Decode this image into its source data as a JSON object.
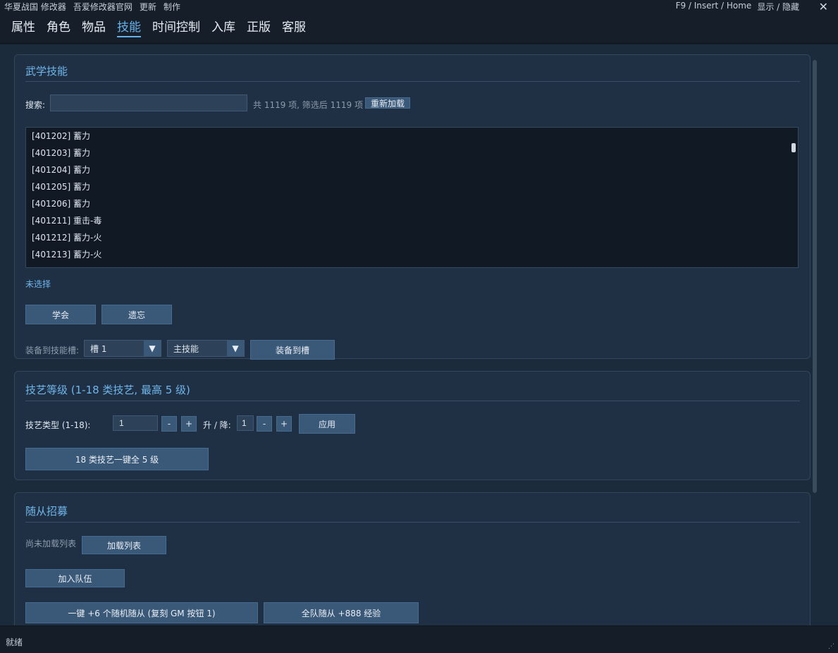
{
  "topbar": {
    "menu": [
      "华夏战国 修改器",
      "吾爱修改器官网",
      "更新",
      "制作"
    ],
    "hotkeys": "F9 / Insert / Home",
    "toggle": "显示 / 隐藏",
    "close": "✕"
  },
  "tabs": [
    {
      "label": "属性"
    },
    {
      "label": "角色"
    },
    {
      "label": "物品"
    },
    {
      "label": "技能",
      "active": true
    },
    {
      "label": "时间控制"
    },
    {
      "label": "入库"
    },
    {
      "label": "正版"
    },
    {
      "label": "客服"
    }
  ],
  "skills": {
    "title": "武学技能",
    "search_label": "搜索:",
    "search_value": "",
    "count_text": "共 1119 项, 筛选后 1119 项",
    "reload_button": "重新加载",
    "list": [
      "[401202] 蓄力",
      "[401203] 蓄力",
      "[401204] 蓄力",
      "[401205] 蓄力",
      "[401206] 蓄力",
      "[401211] 重击-毒",
      "[401212] 蓄力-火",
      "[401213] 蓄力-火"
    ],
    "selection": "未选择",
    "learn_button": "学会",
    "forget_button": "遗忘",
    "equip_label": "装备到技能槽:",
    "slot_value": "槽 1",
    "type_value": "主技能",
    "equip_button": "装备到槽"
  },
  "craft": {
    "title": "技艺等级 (1-18 类技艺, 最高 5 级)",
    "type_label": "技艺类型 (1-18):",
    "type_value": "1",
    "minus": "-",
    "plus": "+",
    "delta_label": "升 / 降:",
    "delta_value": "1",
    "apply_button": "应用",
    "all_button": "18 类技艺一键全 5 级"
  },
  "followers": {
    "title": "随从招募",
    "status": "尚未加载列表",
    "load_button": "加载列表",
    "join_button": "加入队伍",
    "random_button": "一键 +6 个随机随从 (复刻 GM 按钮 1)",
    "exp_button": "全队随从 +888 经验"
  },
  "statusbar": {
    "text": "就绪"
  },
  "colors": {
    "accent": "#66b1ea",
    "button": "#3a5878",
    "panel": "#1f3045"
  }
}
